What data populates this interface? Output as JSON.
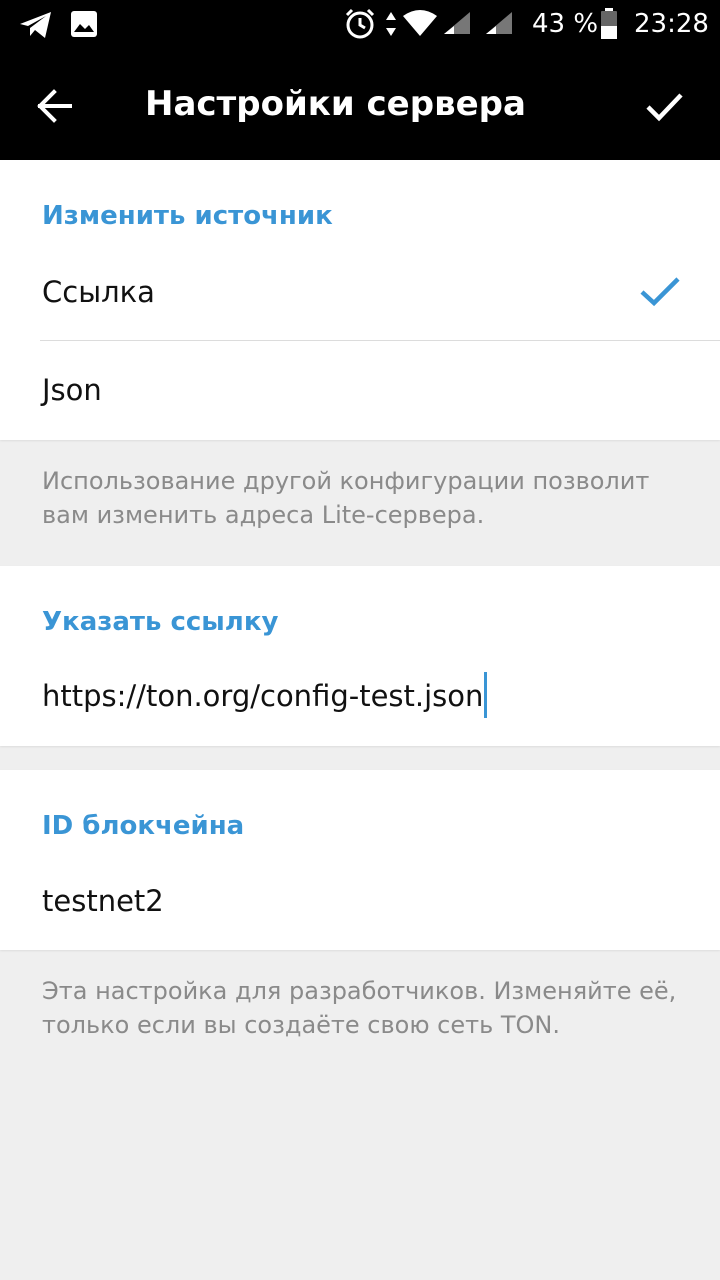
{
  "status_bar": {
    "battery_percent": "43 %",
    "time": "23:28",
    "icons": [
      "telegram-icon",
      "gallery-icon",
      "alarm-icon",
      "data-arrows-icon",
      "wifi-icon",
      "signal-icon",
      "signal-icon",
      "battery-icon"
    ]
  },
  "header": {
    "title": "Настройки сервера",
    "back_icon": "back-arrow-icon",
    "done_icon": "checkmark-icon"
  },
  "source_section": {
    "title": "Изменить источник",
    "options": [
      {
        "label": "Ссылка",
        "selected": true
      },
      {
        "label": "Json",
        "selected": false
      }
    ],
    "info": "Использование другой конфигурации позволит вам изменить адреса Lite-сервера."
  },
  "url_section": {
    "title": "Указать ссылку",
    "value": "https://ton.org/config-test.json"
  },
  "blockchain_section": {
    "title": "ID блокчейна",
    "value": "testnet2",
    "info": "Эта настройка для разработчиков. Изменяйте её, только если вы создаёте свою сеть TON."
  },
  "colors": {
    "accent": "#3a95d5",
    "header_bg": "#000000",
    "page_bg": "#efefef",
    "info_text": "#8a8a8a"
  }
}
